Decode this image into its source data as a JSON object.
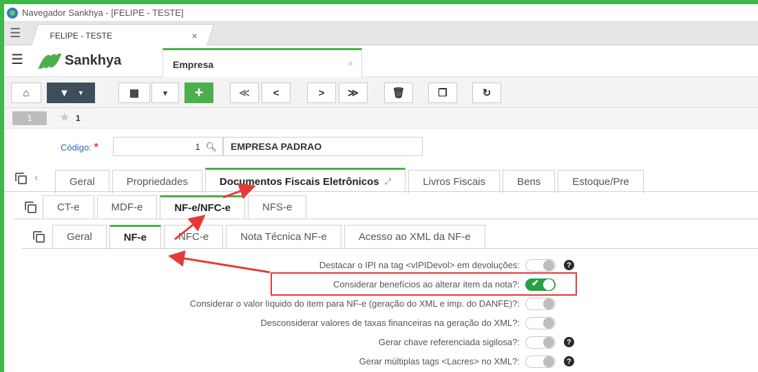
{
  "window": {
    "title": "Navegador Sankhya - [FELIPE - TESTE]"
  },
  "browser_tab": {
    "label": "FELIPE - TESTE",
    "close": "×"
  },
  "app": {
    "brand": "Sankhya",
    "tab_label": "Empresa",
    "tab_close": "×"
  },
  "toolbar": {
    "buttons": [
      "home",
      "filter",
      "grid",
      "add",
      "first",
      "previous",
      "next",
      "last",
      "delete",
      "duplicate",
      "refresh"
    ],
    "glyphs": {
      "first": "≪",
      "previous": "<",
      "next": ">",
      "last": "≫"
    }
  },
  "record": {
    "index": "1",
    "number": "1"
  },
  "form": {
    "codigo_label": "Código:",
    "required_mark": "*",
    "codigo_value": "1",
    "empresa_name": "EMPRESA PADRAO"
  },
  "tabs_level1": {
    "items": [
      "Geral",
      "Propriedades",
      "Documentos Fiscais Eletrônicos",
      "Livros Fiscais",
      "Bens",
      "Estoque/Pre"
    ],
    "active": "Documentos Fiscais Eletrônicos"
  },
  "tabs_level2": {
    "items": [
      "CT-e",
      "MDF-e",
      "NF-e/NFC-e",
      "NFS-e"
    ],
    "active": "NF-e/NFC-e"
  },
  "tabs_level3": {
    "items": [
      "Geral",
      "NF-e",
      "NFC-e",
      "Nota Técnica NF-e",
      "Acesso ao XML da NF-e"
    ],
    "active": "NF-e"
  },
  "options": [
    {
      "label": "Destacar o IPI na tag <vIPIDevol> em devoluções:",
      "enabled": false,
      "help": true
    },
    {
      "label": "Considerar benefícios ao alterar item da nota?:",
      "enabled": true,
      "help": false
    },
    {
      "label": "Considerar o valor líquido do item para NF-e (geração do XML e imp. do DANFE)?:",
      "enabled": false,
      "help": false
    },
    {
      "label": "Desconsiderar valores de taxas financeiras na geração do XML?:",
      "enabled": false,
      "help": false
    },
    {
      "label": "Gerar chave referenciada sigilosa?:",
      "enabled": false,
      "help": true
    },
    {
      "label": "Gerar múltiplas tags <Lacres> no XML?:",
      "enabled": false,
      "help": true
    }
  ],
  "colors": {
    "accent": "#4cae4c",
    "toggle_on": "#27a046",
    "highlight": "#e53935",
    "link": "#2a6db5"
  }
}
